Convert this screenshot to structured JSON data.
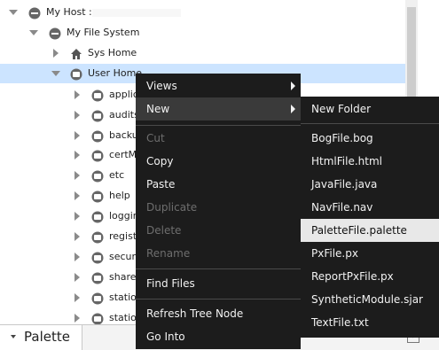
{
  "tree": {
    "root_label": "My Host :",
    "filesystem_label": "My File System",
    "syshome_label": "Sys Home",
    "userhome_label": "User Home",
    "children": [
      "applic",
      "audits",
      "backu",
      "certMa",
      "etc",
      "help",
      "loggin",
      "registr",
      "securi",
      "shared",
      "statio",
      "statio"
    ]
  },
  "context_menu": {
    "views": "Views",
    "new": "New",
    "cut": "Cut",
    "copy": "Copy",
    "paste": "Paste",
    "duplicate": "Duplicate",
    "delete": "Delete",
    "rename": "Rename",
    "find_files": "Find Files",
    "refresh": "Refresh Tree Node",
    "go_into": "Go Into"
  },
  "submenu": {
    "new_folder": "New Folder",
    "bog": "BogFile.bog",
    "html": "HtmlFile.html",
    "java": "JavaFile.java",
    "nav": "NavFile.nav",
    "palette": "PaletteFile.palette",
    "px": "PxFile.px",
    "reportpx": "ReportPxFile.px",
    "synthetic": "SyntheticModule.sjar",
    "text": "TextFile.txt"
  },
  "palette_panel": {
    "title": "Palette"
  },
  "colors": {
    "menu_bg": "#1c1c1c",
    "selection": "#cce4ff",
    "highlight": "#e8e8e8"
  },
  "icons": [
    "expand-arrow-icon",
    "collapse-arrow-icon",
    "host-icon",
    "drive-icon",
    "house-icon",
    "folder-icon",
    "submenu-arrow-icon",
    "maximize-icon"
  ]
}
